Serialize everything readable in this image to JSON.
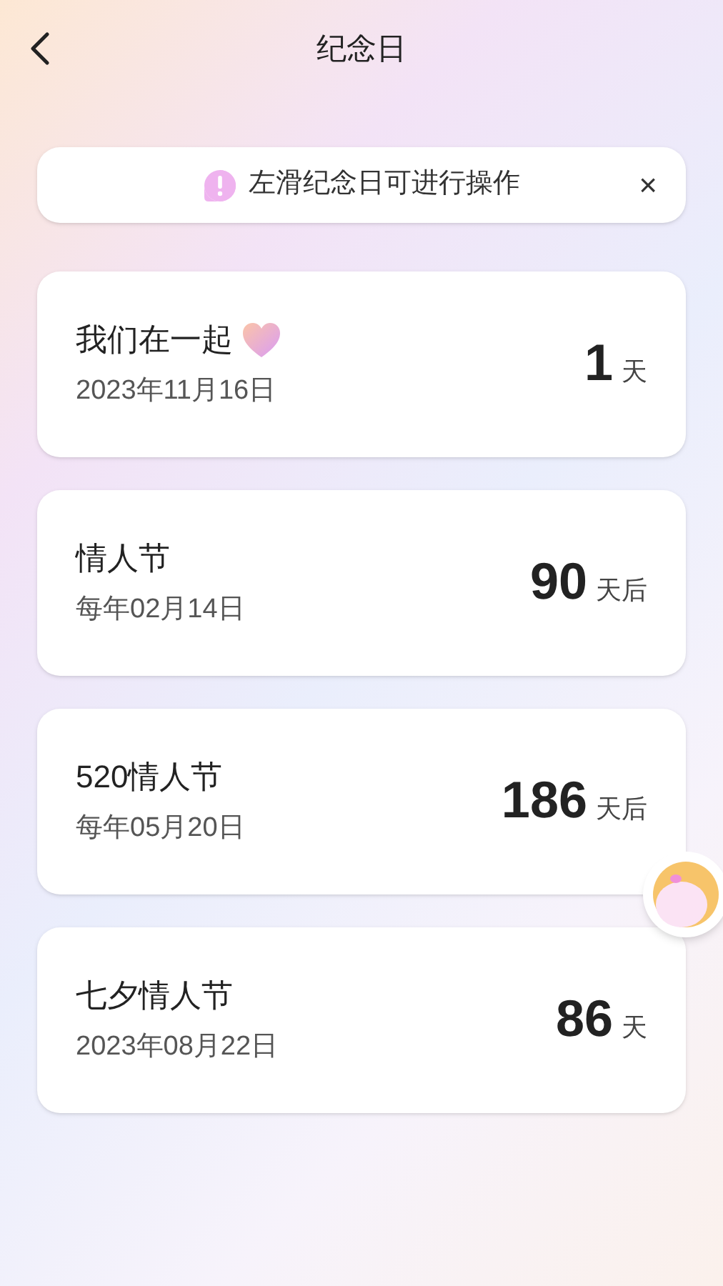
{
  "header": {
    "title": "纪念日"
  },
  "tip": {
    "text": "左滑纪念日可进行操作",
    "close": "×"
  },
  "anniversaries": [
    {
      "name": "我们在一起",
      "heart": true,
      "date": "2023年11月16日",
      "count": "1",
      "unit": "天"
    },
    {
      "name": "情人节",
      "heart": false,
      "date": "每年02月14日",
      "count": "90",
      "unit": "天后"
    },
    {
      "name": "520情人节",
      "heart": false,
      "date": "每年05月20日",
      "count": "186",
      "unit": "天后"
    },
    {
      "name": "七夕情人节",
      "heart": false,
      "date": "2023年08月22日",
      "count": "86",
      "unit": "天"
    }
  ]
}
